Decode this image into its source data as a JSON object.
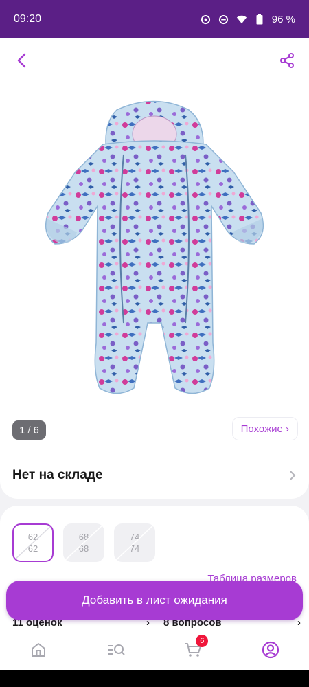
{
  "status": {
    "time": "09:20",
    "battery": "96 %"
  },
  "gallery": {
    "current": "1",
    "separator": "/",
    "total": "6"
  },
  "similar_label": "Похожие ›",
  "stock_label": "Нет на складе",
  "sizes": [
    {
      "top": "62",
      "bottom": "62",
      "selected": true
    },
    {
      "top": "68",
      "bottom": "68",
      "selected": false
    },
    {
      "top": "74",
      "bottom": "74",
      "selected": false
    }
  ],
  "size_table_label": "Таблица размеров",
  "reviews_label": "11 оценок",
  "questions_label": "8 вопросов",
  "cta_label": "Добавить в лист ожидания",
  "cart_badge": "6",
  "colors": {
    "brand": "#a73bd3",
    "statusbar": "#5b1f86",
    "badge": "#f0163b"
  },
  "icons": {
    "back": "chevron-left-icon",
    "share": "share-icon",
    "home": "home-icon",
    "catalog": "catalog-search-icon",
    "cart": "cart-icon",
    "profile": "profile-icon"
  }
}
